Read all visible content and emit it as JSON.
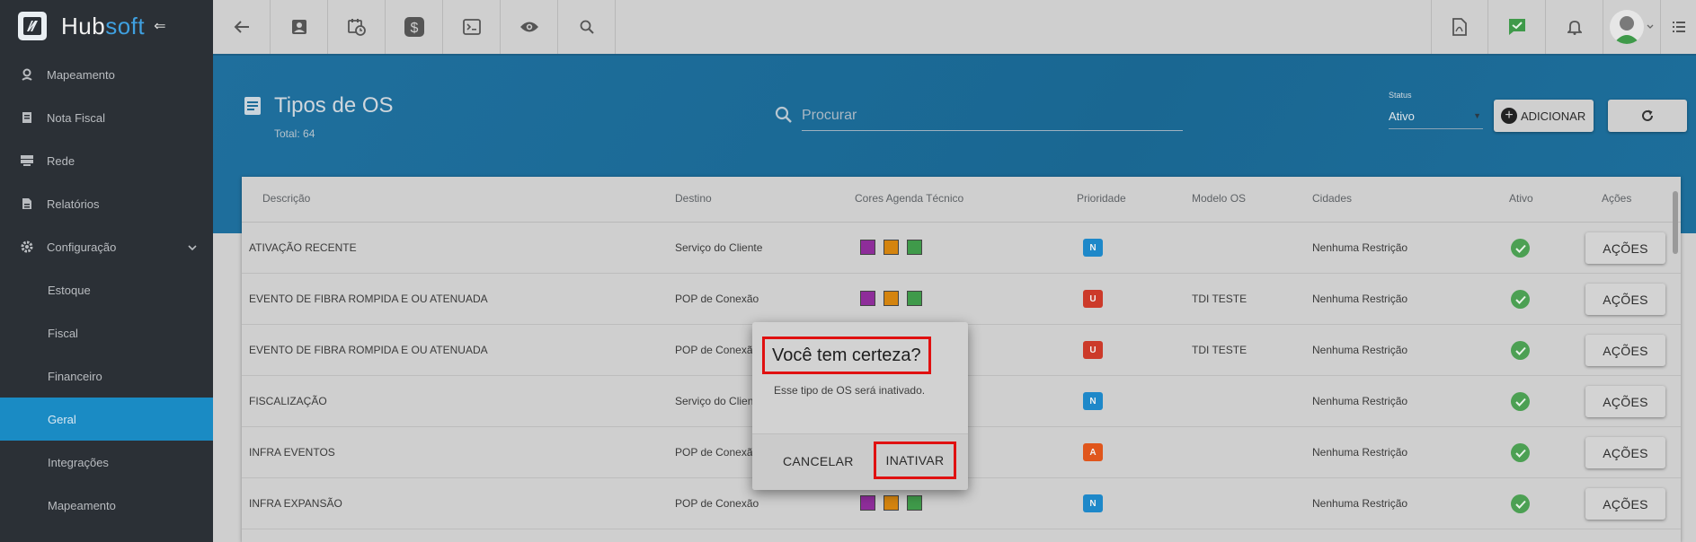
{
  "brand": {
    "name_main": "Hub",
    "name_accent": "soft"
  },
  "sidebar": {
    "items": [
      {
        "label": "Mapeamento"
      },
      {
        "label": "Nota Fiscal"
      },
      {
        "label": "Rede"
      },
      {
        "label": "Relatórios"
      },
      {
        "label": "Configuração"
      },
      {
        "label": "Estoque"
      },
      {
        "label": "Fiscal"
      },
      {
        "label": "Financeiro"
      },
      {
        "label": "Geral"
      },
      {
        "label": "Integrações"
      },
      {
        "label": "Mapeamento"
      }
    ],
    "active": "Geral"
  },
  "header": {
    "title": "Tipos de OS",
    "total": "Total: 64",
    "search_placeholder": "Procurar",
    "status_label": "Status",
    "status_value": "Ativo",
    "add_label": "ADICIONAR"
  },
  "table": {
    "columns": [
      "Descrição",
      "Destino",
      "Cores Agenda Técnico",
      "Prioridade",
      "Modelo OS",
      "Cidades",
      "Ativo",
      "Ações"
    ],
    "rows": [
      {
        "descricao": "ATIVAÇÃO RECENTE",
        "destino": "Serviço do Cliente",
        "prioridade": "N",
        "modelo": "",
        "cidades": "Nenhuma Restrição",
        "acoes": "AÇÕES"
      },
      {
        "descricao": "EVENTO DE FIBRA ROMPIDA E OU ATENUADA",
        "destino": "POP de Conexão",
        "prioridade": "U",
        "modelo": "TDI TESTE",
        "cidades": "Nenhuma Restrição",
        "acoes": "AÇÕES"
      },
      {
        "descricao": "EVENTO DE FIBRA ROMPIDA E OU ATENUADA",
        "destino": "POP de Conexão",
        "prioridade": "U",
        "modelo": "TDI TESTE",
        "cidades": "Nenhuma Restrição",
        "acoes": "AÇÕES"
      },
      {
        "descricao": "FISCALIZAÇÃO",
        "destino": "Serviço do Cliente",
        "prioridade": "N",
        "modelo": "",
        "cidades": "Nenhuma Restrição",
        "acoes": "AÇÕES"
      },
      {
        "descricao": "INFRA EVENTOS",
        "destino": "POP de Conexão",
        "prioridade": "A",
        "modelo": "",
        "cidades": "Nenhuma Restrição",
        "acoes": "AÇÕES"
      },
      {
        "descricao": "INFRA EXPANSÃO",
        "destino": "POP de Conexão",
        "prioridade": "N",
        "modelo": "",
        "cidades": "Nenhuma Restrição",
        "acoes": "AÇÕES"
      }
    ],
    "swatch_colors": [
      "#8e2d9a",
      "#d4840f",
      "#3f9a4a"
    ],
    "priority_colors": {
      "N": "#1e88c9",
      "U": "#cc3a2a",
      "A": "#e0561c"
    },
    "active_color": "#4ca053"
  },
  "dialog": {
    "title": "Você tem certeza?",
    "message": "Esse tipo de OS será inativado.",
    "cancel_label": "CANCELAR",
    "confirm_label": "INATIVAR"
  },
  "colors": {
    "accent": "#1a8bc4",
    "highlight": "#e01010",
    "sidebar_bg": "#2b3036"
  }
}
